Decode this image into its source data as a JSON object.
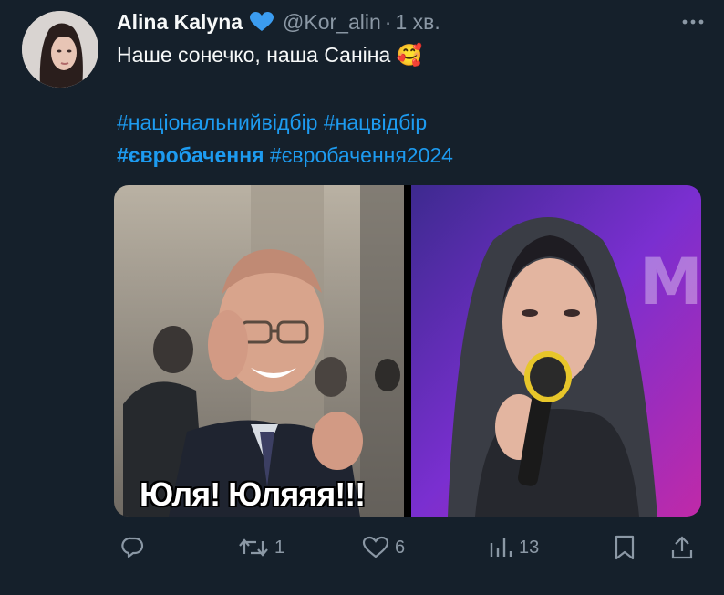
{
  "tweet": {
    "author_name": "Alina Kalyna",
    "verified_icon": "blue-heart-icon",
    "handle": "@Kor_alin",
    "separator": "·",
    "time": "1 хв.",
    "more_icon": "more-dots-icon",
    "text_line1": "Наше сонечко, наша Саніна",
    "emoji": "🥰",
    "hashtags": {
      "tag1": "#національнийвідбір",
      "tag2": "#нацвідбір",
      "tag3": "#євробачення",
      "tag4": "#євробачення2024"
    },
    "media": {
      "left_caption": "Юля! Юляяя!!!"
    }
  },
  "actions": {
    "reply_icon": "reply-icon",
    "retweet_icon": "retweet-icon",
    "retweet_count": "1",
    "like_icon": "heart-icon",
    "like_count": "6",
    "views_icon": "views-icon",
    "views_count": "13",
    "bookmark_icon": "bookmark-icon",
    "share_icon": "share-icon"
  },
  "colors": {
    "background": "#15202b",
    "link": "#1d9bf0",
    "muted": "#8b98a5",
    "text": "#f7f9f9"
  }
}
